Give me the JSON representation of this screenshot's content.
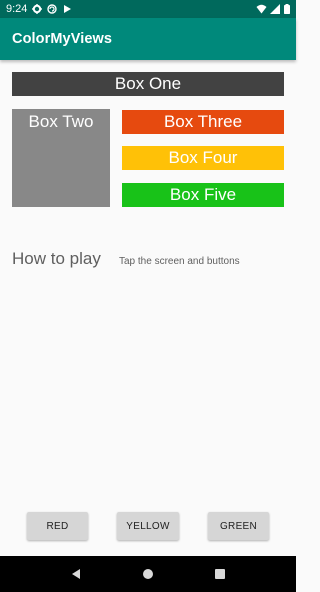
{
  "status_bar": {
    "time": "9:24",
    "icons": [
      "gear-icon",
      "sync-icon",
      "play-store-icon"
    ],
    "right_icons": [
      "wifi-icon",
      "signal-icon",
      "battery-icon"
    ]
  },
  "app_bar": {
    "title": "ColorMyViews"
  },
  "boxes": {
    "one": "Box One",
    "two": "Box Two",
    "three": "Box Three",
    "four": "Box Four",
    "five": "Box Five"
  },
  "colors": {
    "status_bar": "#00695c",
    "app_bar": "#00897b",
    "box_one": "#424242",
    "box_two": "#888888",
    "box_three": "#e64a0f",
    "box_four": "#ffc107",
    "box_five": "#18c218"
  },
  "labels": {
    "how_to_play": "How to play",
    "instructions": "Tap the screen and buttons"
  },
  "buttons": {
    "red": "RED",
    "yellow": "YELLOW",
    "green": "GREEN"
  },
  "nav_bar": {
    "icons": [
      "back-icon",
      "home-icon",
      "recents-icon"
    ]
  }
}
